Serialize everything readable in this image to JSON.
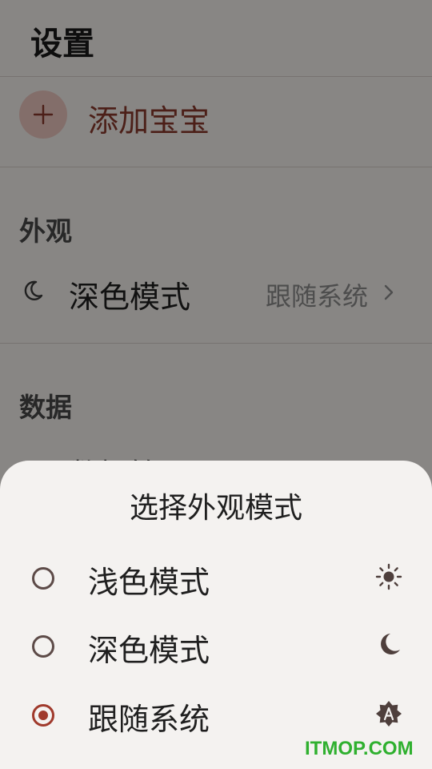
{
  "header": {
    "title": "设置"
  },
  "add_baby": {
    "label": "添加宝宝",
    "icon": "plus-icon"
  },
  "appearance": {
    "section_title": "外观",
    "dark_mode": {
      "label": "深色模式",
      "value": "跟随系统",
      "icon": "moon-outline-icon"
    }
  },
  "data_section": {
    "section_title": "数据",
    "data_management": {
      "label": "数据管理"
    }
  },
  "sheet": {
    "title": "选择外观模式",
    "options": [
      {
        "label": "浅色模式",
        "icon": "sun-icon",
        "selected": false
      },
      {
        "label": "深色模式",
        "icon": "moon-icon",
        "selected": false
      },
      {
        "label": "跟随系统",
        "icon": "auto-brightness-icon",
        "selected": true
      }
    ]
  },
  "watermark": {
    "text": "ITMOP.COM"
  },
  "colors": {
    "accent": "#a03a2c",
    "accent_soft": "#efc9c2",
    "scrim": "#000000",
    "sheet_bg": "#f4f2f0"
  }
}
